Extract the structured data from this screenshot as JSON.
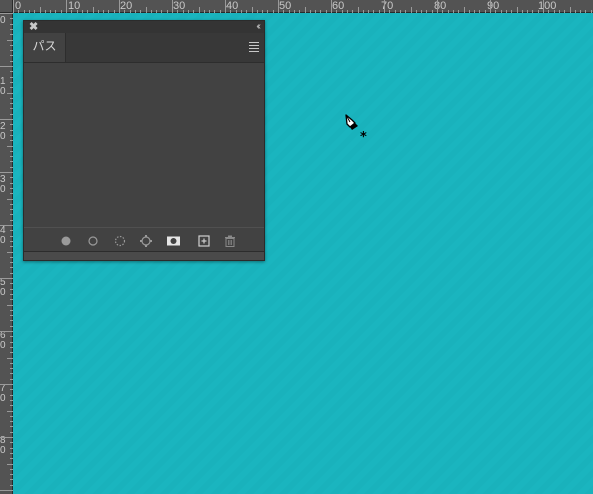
{
  "rulers": {
    "top_labels": [
      "0",
      "10",
      "20",
      "30",
      "40",
      "50",
      "60",
      "70",
      "80",
      "90",
      "100"
    ],
    "left_labels": [
      "0",
      "1 0",
      "2 0",
      "3 0",
      "4 0",
      "5 0",
      "6 0",
      "7 0",
      "8 0"
    ]
  },
  "panel": {
    "close_glyph": "✖",
    "collapse_glyph": "‹‹",
    "tab_label": "パス",
    "menu_icon": "hamburger-menu-icon",
    "footer_buttons": [
      {
        "name": "fill-path-button",
        "icon": "filled-circle-icon"
      },
      {
        "name": "stroke-path-button",
        "icon": "circle-outline-icon"
      },
      {
        "name": "load-as-selection-button",
        "icon": "dashed-circle-icon"
      },
      {
        "name": "make-work-path-button",
        "icon": "path-anchor-icon"
      },
      {
        "name": "add-mask-button",
        "icon": "mask-icon"
      },
      {
        "name": "new-path-button",
        "icon": "plus-square-icon"
      },
      {
        "name": "delete-path-button",
        "icon": "trash-icon"
      }
    ]
  },
  "cursor": {
    "icon": "pen-tool-new-path-cursor-icon"
  },
  "colors": {
    "canvas": "#19b2bc",
    "panel_bg": "#424242",
    "ruler_bg": "#535353"
  }
}
